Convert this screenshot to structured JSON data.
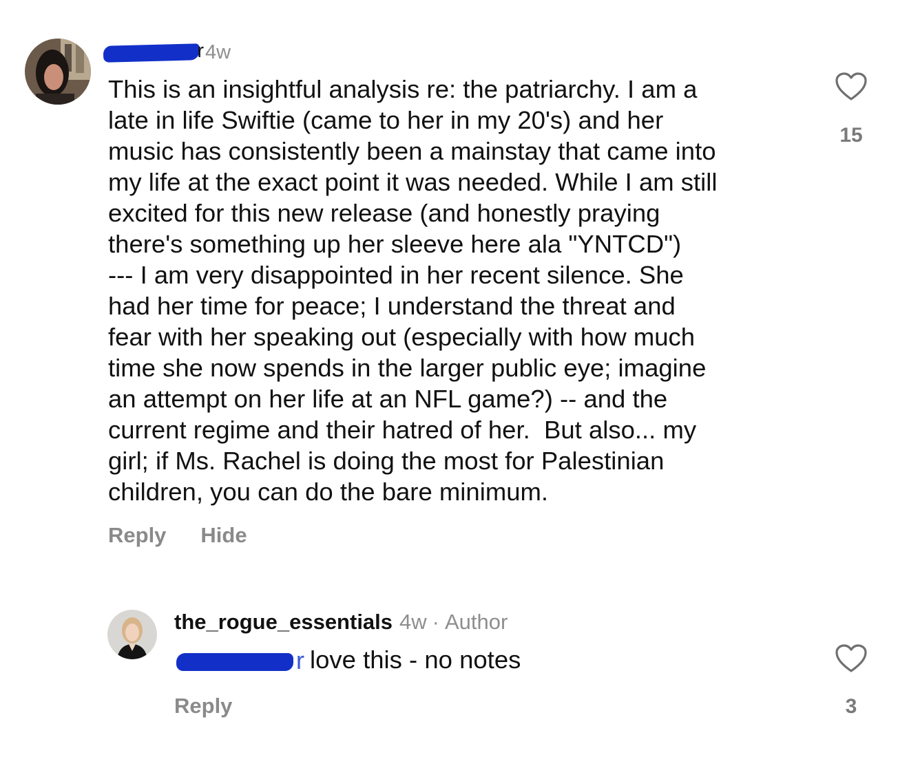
{
  "comment": {
    "username_visible_fragment": "r",
    "time": "4w",
    "body_lines": [
      "This is an insightful analysis re: the patriarchy. I am a",
      "late in life Swiftie (came to her in my 20's) and her",
      "music has consistently been a mainstay that came into",
      "my life at the exact point it was needed. While I am still",
      "excited for this new release (and honestly praying",
      "there's something up her sleeve here ala \"YNTCD\")",
      "--- I am very disappointed in her recent silence. She",
      "had her time for peace; I understand the threat and",
      "fear with her speaking out (especially with how much",
      "time she now spends in the larger public eye; imagine",
      "an attempt on her life at an NFL game?) -- and the",
      "current regime and their hatred of her.  But also... my",
      "girl; if Ms. Rachel is doing the most for Palestinian",
      "children, you can do the bare minimum."
    ],
    "reply_label": "Reply",
    "hide_label": "Hide",
    "like_count": "15",
    "heart_icon": "heart-outline-icon"
  },
  "reply": {
    "username": "the_rogue_essentials",
    "time": "4w",
    "separator": "·",
    "badge": "Author",
    "mention_visible_fragment": "r",
    "text": "love this - no notes",
    "reply_label": "Reply",
    "like_count": "3",
    "heart_icon": "heart-outline-icon"
  },
  "colors": {
    "redaction": "#1230c8",
    "mention": "#3b5bdb",
    "meta_gray": "#8e8e8e"
  }
}
